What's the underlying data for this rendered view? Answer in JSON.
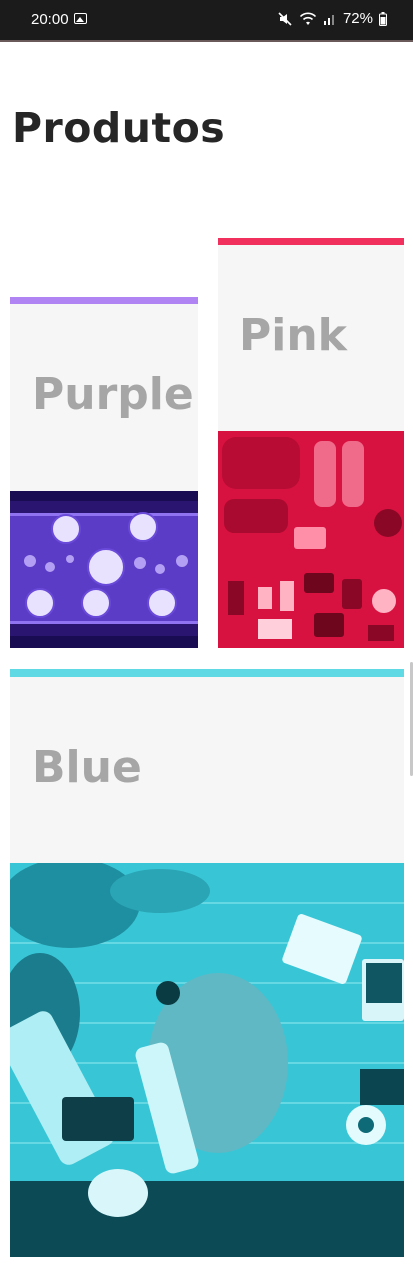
{
  "status_bar": {
    "time": "20:00",
    "battery": "72%",
    "icons": [
      "gallery-icon",
      "mute-icon",
      "wifi-icon",
      "signal-icon",
      "battery-icon"
    ]
  },
  "page": {
    "title": "Produtos"
  },
  "products": [
    {
      "label": "Purple",
      "accent_color": "#b184f4",
      "image_tint": "#6a3ce0",
      "image_subject": "table-setting-photo"
    },
    {
      "label": "Pink",
      "accent_color": "#f2305e",
      "image_tint": "#e0103f",
      "image_subject": "travel-gear-flatlay-photo"
    },
    {
      "label": "Blue",
      "accent_color": "#5fd9e4",
      "image_tint": "#17c6d6",
      "image_subject": "flowers-desk-photo"
    }
  ]
}
